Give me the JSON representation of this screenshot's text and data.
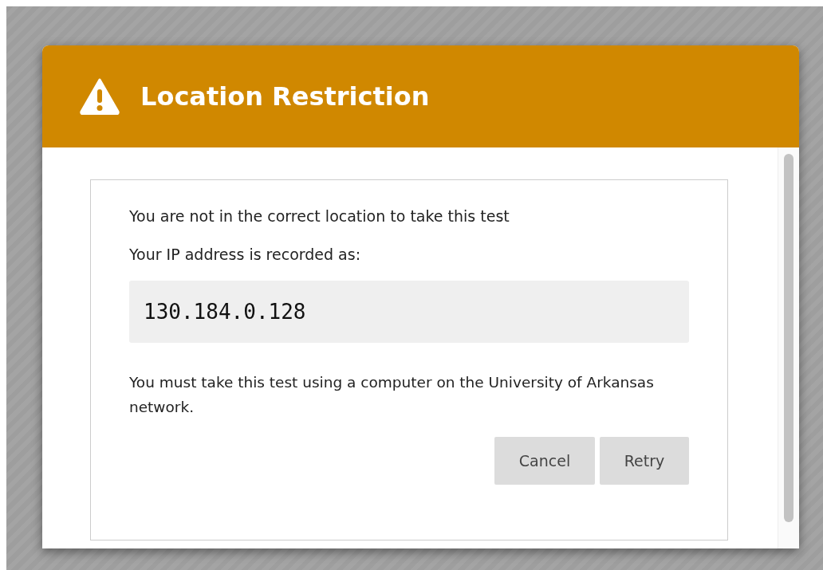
{
  "dialog": {
    "title": "Location Restriction",
    "message": "You are not in the correct location to take this test",
    "ip_label": "Your IP address is recorded as:",
    "ip_address": "130.184.0.128",
    "instruction": "You must take this test using a computer on the University of Arkansas network.",
    "buttons": [
      {
        "label": "Cancel"
      },
      {
        "label": "Retry"
      }
    ]
  }
}
